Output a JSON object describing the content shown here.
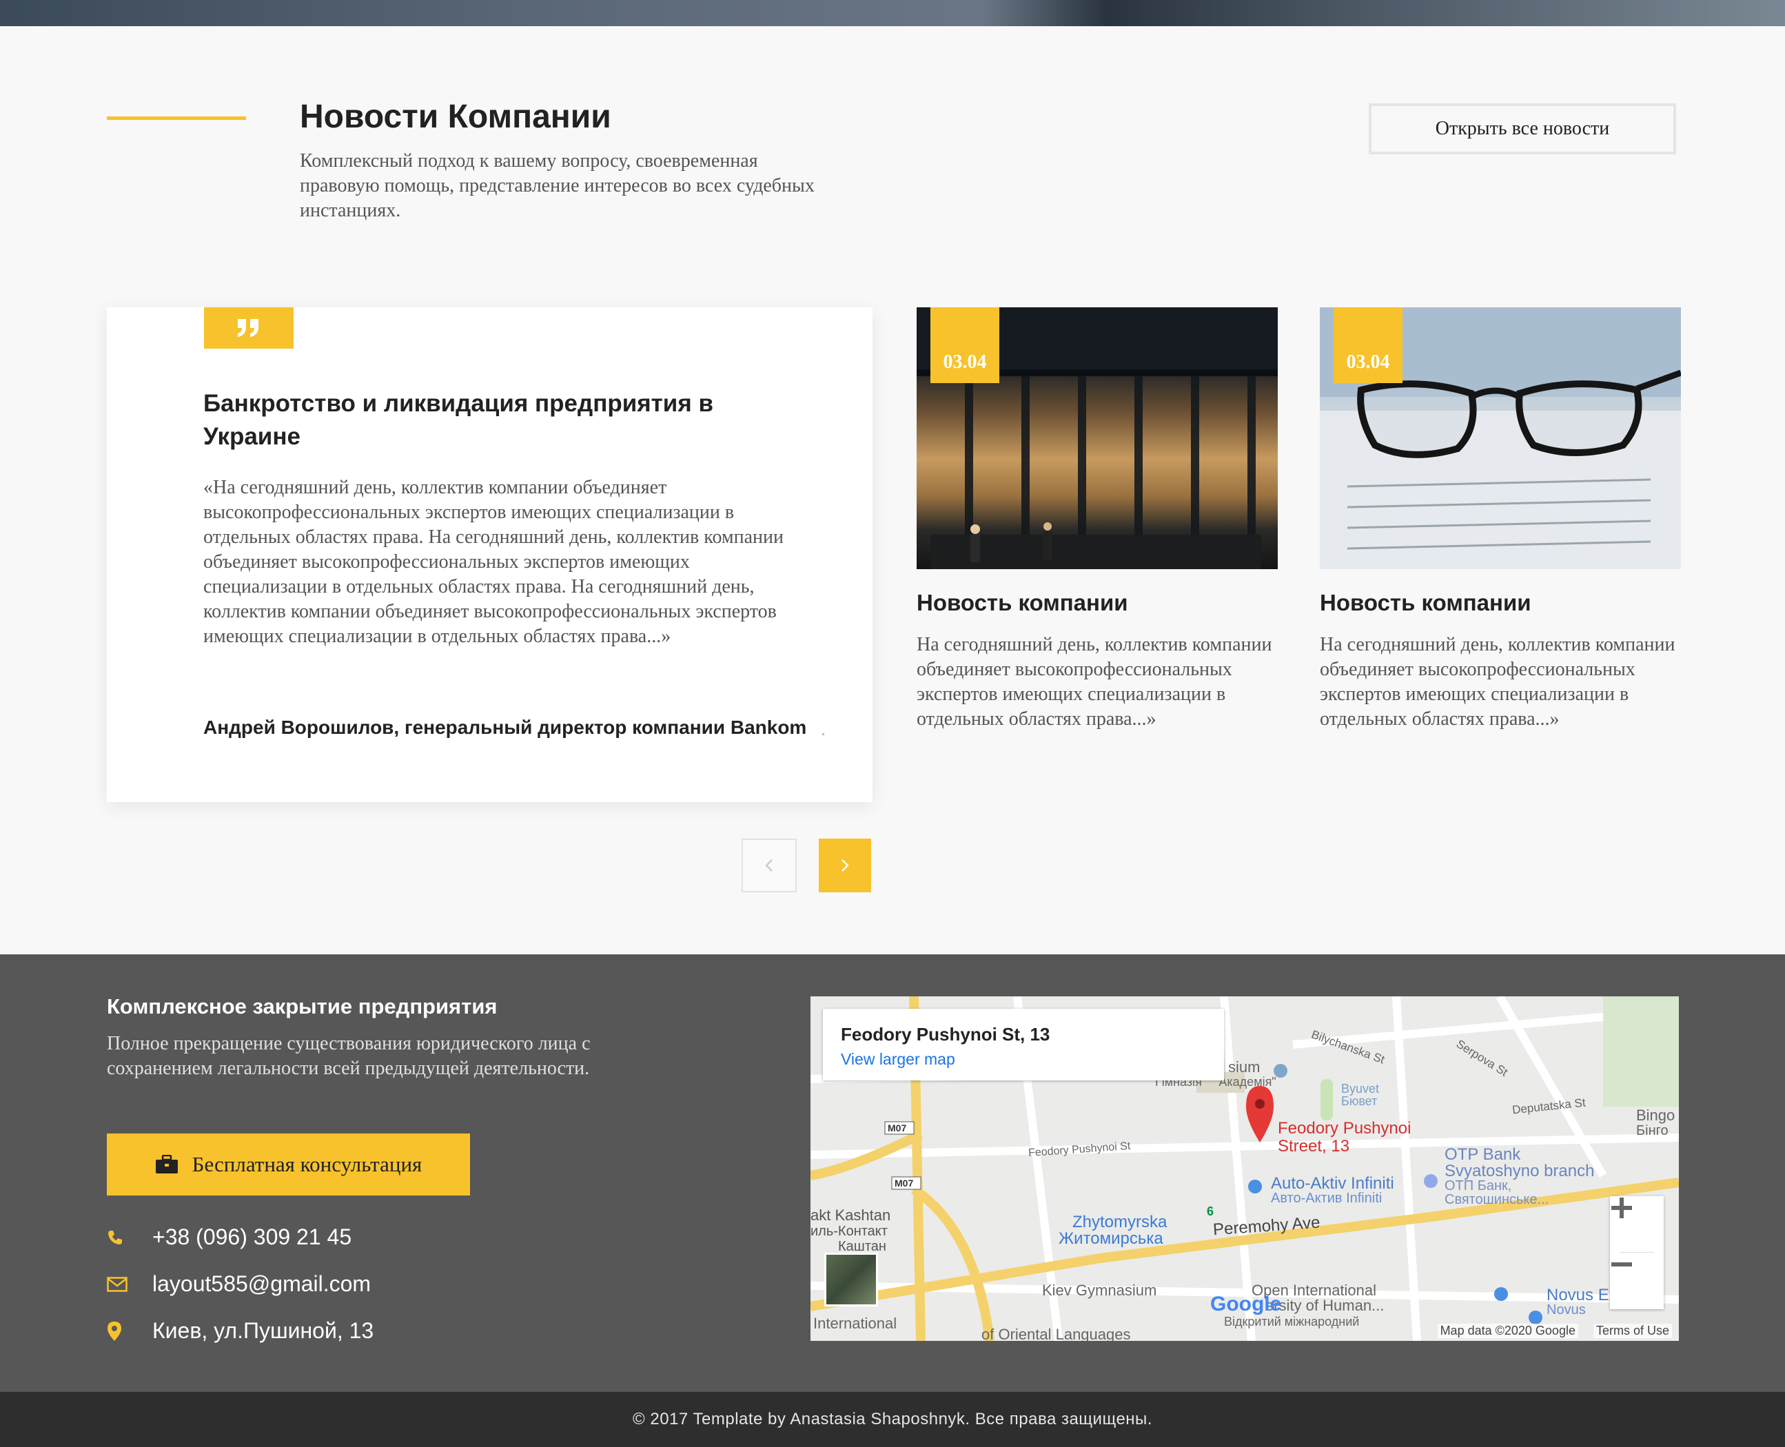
{
  "news": {
    "title": "Новости Компании",
    "description": "Комплексный подход к вашему вопросу, своевременная правовую помощь, представление интересов во всех судебных инстанциях.",
    "open_all_label": "Открыть все новости"
  },
  "quote": {
    "title": "Банкротство и ликвидация предприятия в Украине",
    "text": "«На сегодняшний день, коллектив компании объединяет высокопрофессиональных экспертов имеющих специализации в отдельных областях права. На сегодняшний день, коллектив компании объединяет высокопрофессиональных экспертов имеющих специализации в отдельных областях права. На сегодняшний день, коллектив компании объединяет высокопрофессиональных экспертов имеющих специализации в отдельных областях права...»",
    "author": "Андрей Ворошилов, генеральный директор компании Bankom"
  },
  "cards": [
    {
      "date": "03.04",
      "title": "Новость компании",
      "text": "На сегодняшний день, коллектив компании объединяет высокопрофессиональных экспертов имеющих специализации в отдельных областях права...»"
    },
    {
      "date": "03.04",
      "title": "Новость компании",
      "text": "На сегодняшний день, коллектив компании объединяет высокопрофессиональных экспертов имеющих специализации в отдельных областях права...»"
    }
  ],
  "footer": {
    "title": "Комплексное закрытие предприятия",
    "description": "Полное прекращение существования юридического лица с сохранением легальности всей предыдущей деятельности.",
    "consult_label": "Бесплатная консультация",
    "phone": "+38 (096) 309 21 45",
    "email": "layout585@gmail.com",
    "address": "Киев, ул.Пушиной, 13"
  },
  "map": {
    "address": "Feodory Pushynoi St, 13",
    "view_larger": "View larger map",
    "pin_label_line1": "Feodory Pushynoi",
    "pin_label_line2": "Street, 13",
    "labels": {
      "auto_aktiv": "Auto-Aktiv Infiniti",
      "auto_aktiv_ua": "Авто-Актив Infiniti",
      "otp": "OTP Bank",
      "otp_branch": "Svyatoshyno branch",
      "otp_ua": "ОТП Банк,",
      "otp_ua2": "Святошинське...",
      "zhytomyrska": "Zhytomyrska",
      "zhytomyrska_ua": "Житомирська",
      "peremohy": "Peremohy Ave",
      "kashtan": "akt Kashtan",
      "kashtan2": "иль-Контакт",
      "kashtan3": "Каштан",
      "open_intl": "Open International",
      "univ": "ersity of Human...",
      "univ_ua": "Відкритий міжнародний",
      "kiev_gym": "Kiev Gymnasium",
      "oriental": "of Oriental Languages",
      "novus": "Novus Express",
      "novus_ua": "Novus",
      "bingo": "Bingo",
      "bingo_ua": "Бінго",
      "byuvet": "Byuvet",
      "byuvet_ua": "Бювет",
      "akademia": "\"Академія\"",
      "gimnazia": "Гімназія",
      "sium": "sium",
      "m07a": "M07",
      "m07b": "M07",
      "feodory_small": "Feodory Pushynoi St",
      "deputatska": "Deputatska St",
      "bilychanska": "Bilychanska St",
      "serpova": "Serpova St",
      "international": "International",
      "six": "6"
    },
    "google": "Google",
    "map_data": "Map data ©2020 Google",
    "terms": "Terms of Use"
  },
  "copyright": "© 2017 Template by Anastasia Shaposhnyk. Все права защищены.",
  "colors": {
    "accent": "#f8c22c",
    "footer_bg": "#575757",
    "bottom_bg": "#2e2e2e"
  }
}
